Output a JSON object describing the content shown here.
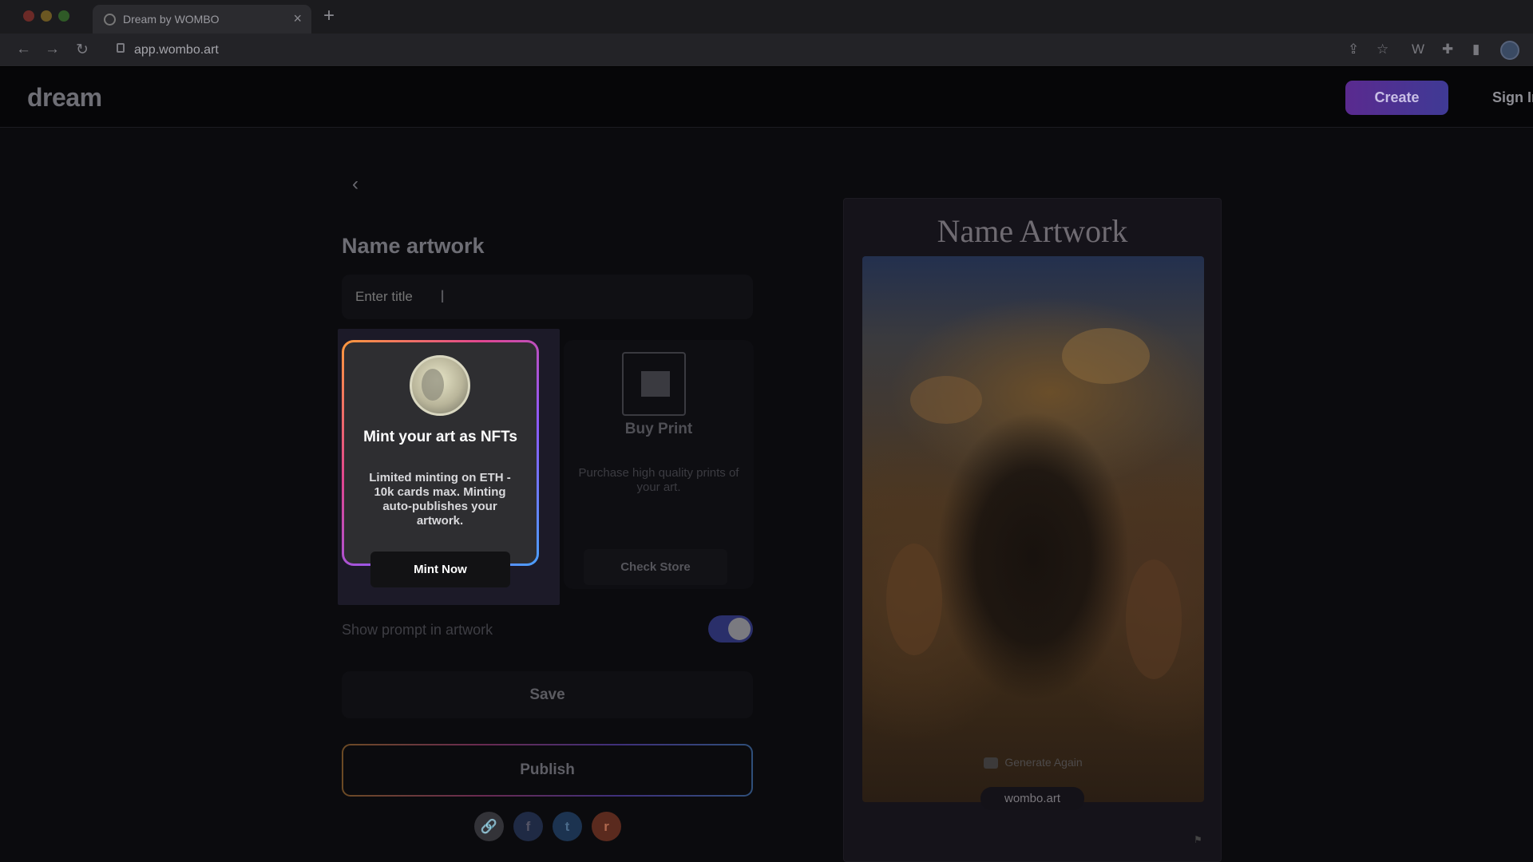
{
  "browser": {
    "tab_title": "Dream by WOMBO",
    "tab_close": "×",
    "new_tab": "+",
    "url": "app.wombo.art",
    "nav": {
      "back": "←",
      "forward": "→",
      "reload": "↻"
    },
    "extensions": {
      "share": "⇪",
      "star": "☆",
      "wombo": "W",
      "puzzle": "✚",
      "sidebar": "▮"
    }
  },
  "site": {
    "logo": "dream",
    "create_label": "Create",
    "signin_label": "Sign In"
  },
  "form": {
    "back_symbol": "‹",
    "heading": "Name artwork",
    "title_placeholder": "Enter title",
    "ibeam": "I",
    "mint_card": {
      "title": "Mint your art as NFTs",
      "description": "Limited minting on ETH - 10k cards max. Minting auto-publishes your artwork.",
      "button": "Mint Now"
    },
    "print_card": {
      "title": "Buy Print",
      "description": "Purchase high quality prints of your art.",
      "button": "Check Store"
    },
    "prompt_toggle": {
      "label": "Show prompt in artwork",
      "on": true
    },
    "save_label": "Save",
    "publish_label": "Publish",
    "share": {
      "link": "🔗",
      "facebook": "f",
      "twitter": "t",
      "reddit": "r"
    }
  },
  "preview": {
    "title": "Name Artwork",
    "generate_again": "Generate Again",
    "watermark": "wombo.art",
    "mini_icon": "⚑"
  },
  "colors": {
    "accent_gradient_start": "#5a2a8f",
    "accent_gradient_end": "#3f3a95",
    "toggle_on": "#2a2f6a"
  }
}
